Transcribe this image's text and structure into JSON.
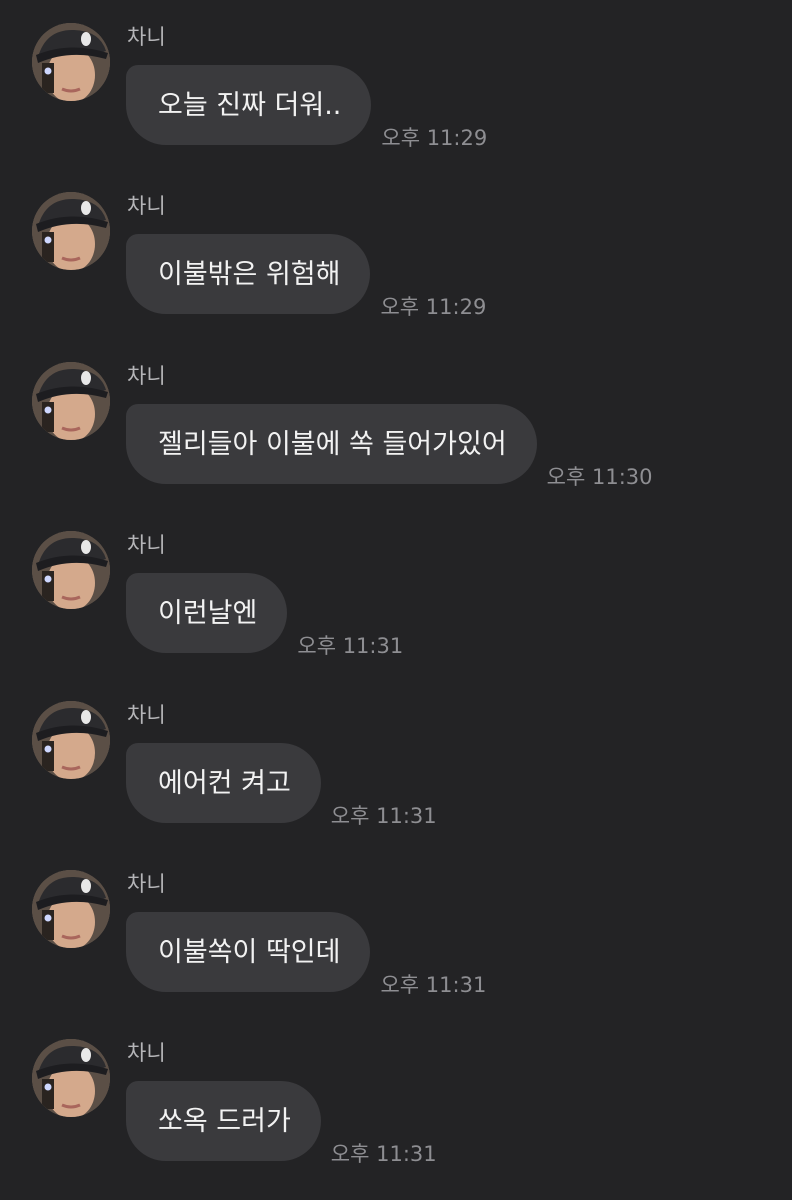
{
  "messages": [
    {
      "sender": "차니",
      "text": "오늘 진짜 더워..",
      "time": "오후 11:29"
    },
    {
      "sender": "차니",
      "text": "이불밖은 위험해",
      "time": "오후 11:29"
    },
    {
      "sender": "차니",
      "text": "젤리들아 이불에 쏙 들어가있어",
      "time": "오후 11:30"
    },
    {
      "sender": "차니",
      "text": "이런날엔",
      "time": "오후 11:31"
    },
    {
      "sender": "차니",
      "text": "에어컨 켜고",
      "time": "오후 11:31"
    },
    {
      "sender": "차니",
      "text": "이불쏙이 딱인데",
      "time": "오후 11:31"
    },
    {
      "sender": "차니",
      "text": "쏘옥 드러가",
      "time": "오후 11:31"
    }
  ],
  "colors": {
    "background": "#232325",
    "bubble": "#3a3a3d",
    "message_text": "#f2f2f2",
    "sender_text": "#b5b5b8",
    "timestamp_text": "#8e8e92"
  },
  "icons": {
    "avatar": "profile-photo"
  }
}
